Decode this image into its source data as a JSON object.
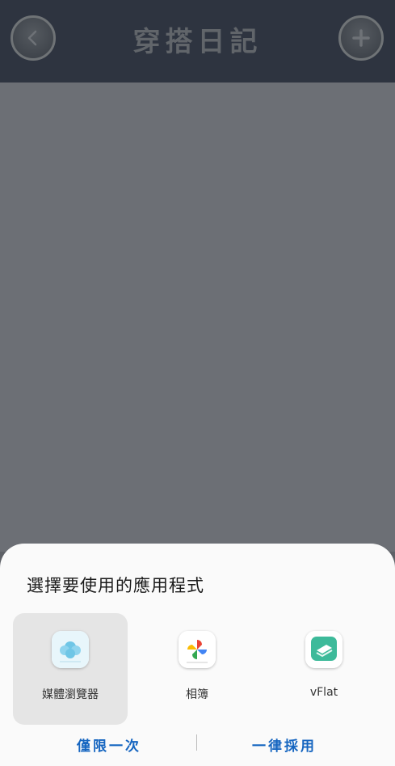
{
  "header": {
    "title": "穿搭日記",
    "back_icon": "chevron-left-icon",
    "add_icon": "plus-icon"
  },
  "chooser": {
    "title": "選擇要使用的應用程式",
    "apps": [
      {
        "label": "媒體瀏覽器",
        "icon": "media-browser-icon",
        "selected": true
      },
      {
        "label": "相簿",
        "icon": "photos-pinwheel-icon",
        "selected": false
      },
      {
        "label": "vFlat",
        "icon": "vflat-icon",
        "selected": false
      }
    ],
    "just_once": "僅限一次",
    "always": "一律採用"
  },
  "colors": {
    "accent": "#1565c0",
    "header_bg": "#2e3440",
    "scrim": "#6c6f75"
  }
}
